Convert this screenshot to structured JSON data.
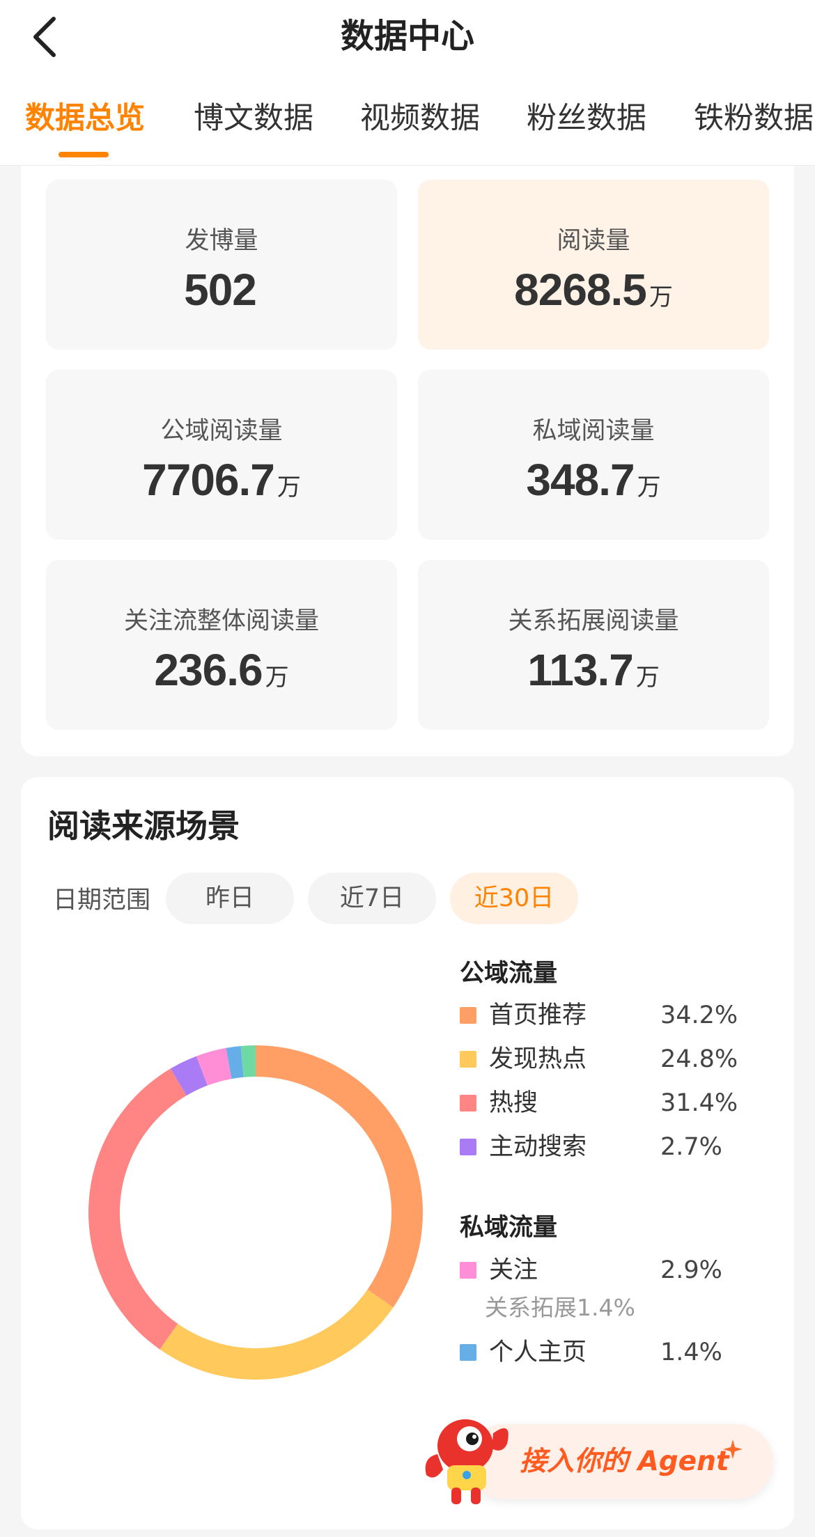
{
  "header": {
    "title": "数据中心",
    "back_icon": "chevron-left-icon"
  },
  "tabs": [
    {
      "label": "数据总览",
      "active": true
    },
    {
      "label": "博文数据",
      "active": false
    },
    {
      "label": "视频数据",
      "active": false
    },
    {
      "label": "粉丝数据",
      "active": false
    },
    {
      "label": "铁粉数据",
      "active": false
    }
  ],
  "stats": [
    {
      "label": "发博量",
      "value": "502",
      "unit": ""
    },
    {
      "label": "阅读量",
      "value": "8268.5",
      "unit": "万",
      "highlighted": true
    },
    {
      "label": "公域阅读量",
      "value": "7706.7",
      "unit": "万"
    },
    {
      "label": "私域阅读量",
      "value": "348.7",
      "unit": "万"
    },
    {
      "label": "关注流整体阅读量",
      "value": "236.6",
      "unit": "万"
    },
    {
      "label": "关系拓展阅读量",
      "value": "113.7",
      "unit": "万"
    }
  ],
  "source": {
    "title": "阅读来源场景",
    "range_label": "日期范围",
    "ranges": [
      {
        "label": "昨日",
        "active": false
      },
      {
        "label": "近7日",
        "active": false
      },
      {
        "label": "近30日",
        "active": true
      }
    ],
    "public_title": "公域流量",
    "private_title": "私域流量",
    "public_items": [
      {
        "name": "首页推荐",
        "pct": "34.2%",
        "color": "#ff9f66"
      },
      {
        "name": "发现热点",
        "pct": "24.8%",
        "color": "#ffc95c"
      },
      {
        "name": "热搜",
        "pct": "31.4%",
        "color": "#ff8585"
      },
      {
        "name": "主动搜索",
        "pct": "2.7%",
        "color": "#a97cf5"
      }
    ],
    "private_items": [
      {
        "name": "关注",
        "pct": "2.9%",
        "color": "#ff8ed6"
      },
      {
        "name": "个人主页",
        "pct": "1.4%",
        "color": "#66aee8"
      }
    ],
    "private_sub": "关系拓展1.4%"
  },
  "chart_data": {
    "type": "pie",
    "donut": true,
    "categories": [
      "首页推荐",
      "发现热点",
      "热搜",
      "主动搜索",
      "关注",
      "个人主页",
      "关系拓展"
    ],
    "values": [
      34.2,
      24.8,
      31.4,
      2.7,
      2.9,
      1.4,
      1.4
    ],
    "colors": [
      "#ff9f66",
      "#ffc95c",
      "#ff8585",
      "#a97cf5",
      "#ff8ed6",
      "#66aee8",
      "#6fd9a3"
    ]
  },
  "agent_banner": {
    "label": "接入你的 Agent",
    "mascot_icon": "mascot-icon",
    "sparkle_icon": "sparkle-icon"
  }
}
